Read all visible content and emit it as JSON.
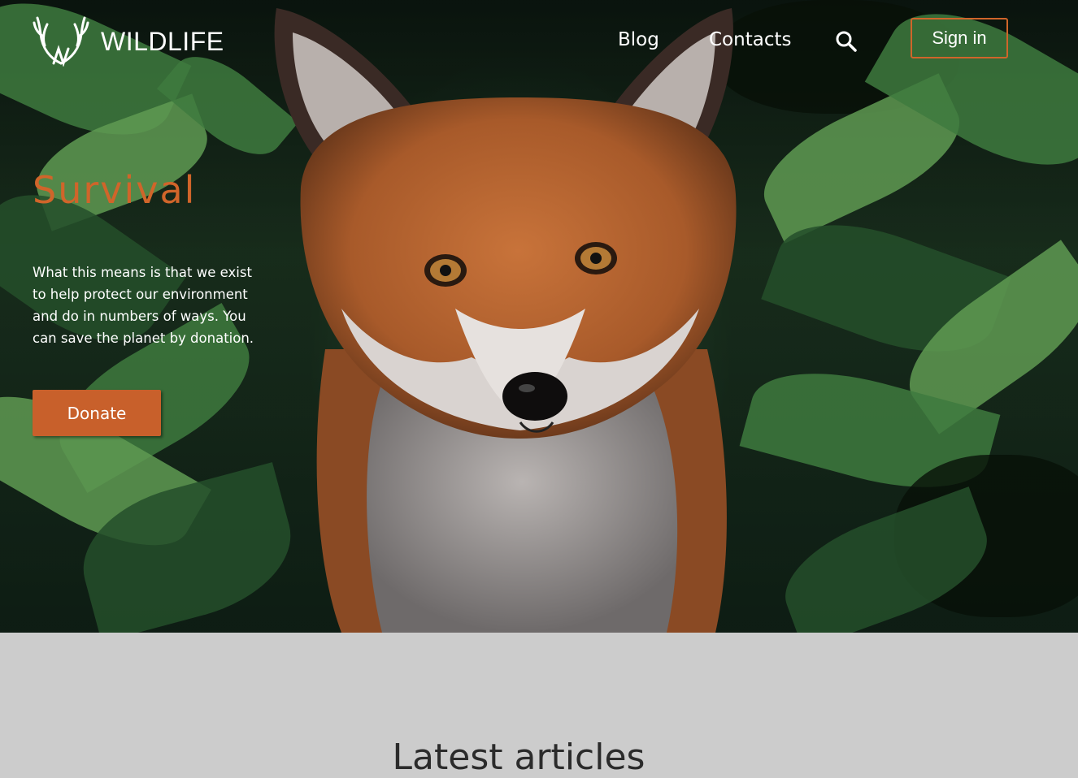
{
  "header": {
    "logo_text": "WILDLIFE",
    "logo_icon": "antlers-icon",
    "nav": [
      {
        "label": "Blog"
      },
      {
        "label": "Contacts"
      }
    ],
    "search_icon": "search-icon",
    "sign_in_label": "Sign in"
  },
  "hero": {
    "title": "Survival",
    "text": "What this means is that we exist to help protect our environment and do in numbers of ways. You can save the planet by donation.",
    "donate_label": "Donate",
    "background_image": "fox-in-foliage"
  },
  "articles": {
    "title": "Latest articles"
  },
  "colors": {
    "accent": "#d0652a",
    "button": "#c8602b",
    "section_bg": "#cccccc",
    "text_light": "#ffffff"
  }
}
